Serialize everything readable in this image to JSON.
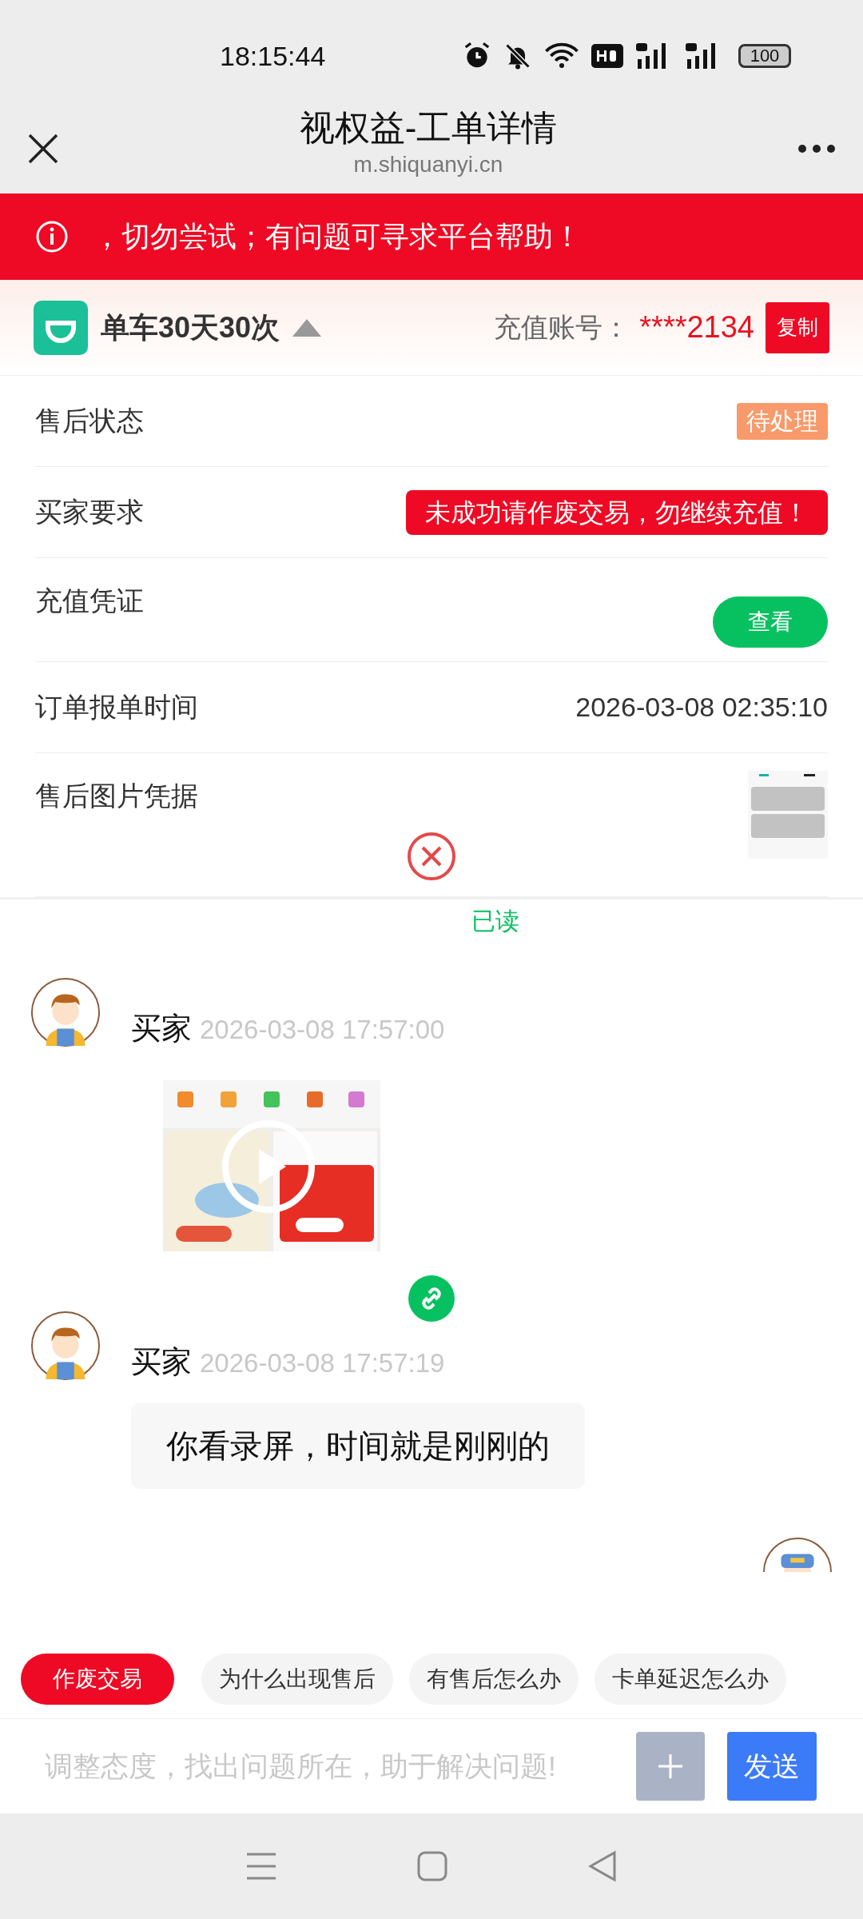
{
  "status_bar": {
    "time": "18:15:44",
    "battery": "100"
  },
  "header": {
    "title": "视权益-工单详情",
    "url": "m.shiquanyi.cn"
  },
  "notice": {
    "text": "，切勿尝试；有问题可寻求平台帮助！"
  },
  "product": {
    "name": "单车30天30次",
    "account_label": "充值账号：",
    "account": "****2134",
    "copy_button": "复制"
  },
  "details": [
    {
      "label": "售后状态",
      "kind": "badge",
      "value": "待处理"
    },
    {
      "label": "买家要求",
      "kind": "alert",
      "value": "未成功请作废交易，勿继续充值！"
    },
    {
      "label": "充值凭证",
      "kind": "button",
      "value": "查看"
    },
    {
      "label": "订单报单时间",
      "kind": "text",
      "value": "2026-03-08 02:35:10"
    },
    {
      "label": "售后图片凭据"
    }
  ],
  "read_status": "已读",
  "messages": [
    {
      "kind": "video",
      "sender": "买家",
      "time": "2026-03-08 17:57:00"
    },
    {
      "kind": "text",
      "sender": "买家",
      "time": "2026-03-08 17:57:19",
      "text": "你看录屏，时间就是刚刚的"
    },
    {
      "kind": "cutoff"
    }
  ],
  "quick_replies": [
    {
      "label": "作废交易",
      "selected": true
    },
    {
      "label": "为什么出现售后",
      "selected": false
    },
    {
      "label": "有售后怎么办",
      "selected": false
    },
    {
      "label": "卡单延迟怎么办",
      "selected": false
    }
  ],
  "composer": {
    "placeholder": "调整态度，找出问题所在，助于解决问题!",
    "send_button": "发送"
  }
}
